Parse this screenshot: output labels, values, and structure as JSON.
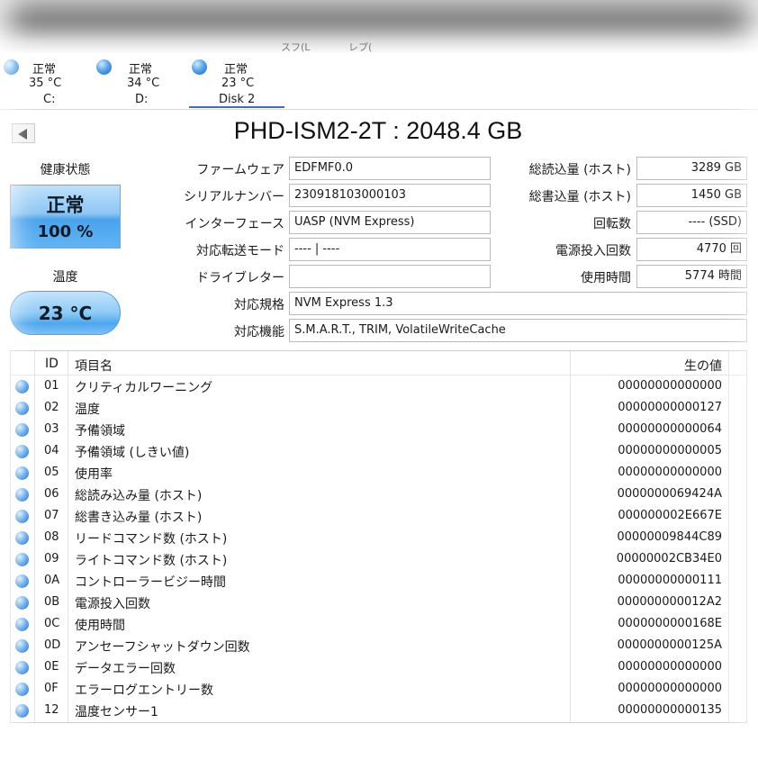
{
  "menu": [
    "スフ(L",
    "レプ("
  ],
  "disks": [
    {
      "status": "正常",
      "temp": "35 °C",
      "letter": "C:"
    },
    {
      "status": "正常",
      "temp": "34 °C",
      "letter": "D:"
    },
    {
      "status": "正常",
      "temp": "23 °C",
      "letter": "Disk 2"
    }
  ],
  "title": "PHD-ISM2-2T : 2048.4 GB",
  "health": {
    "label": "健康状態",
    "status": "正常",
    "percent": "100 %"
  },
  "temperature": {
    "label": "温度",
    "value": "23 °C"
  },
  "info_left": [
    {
      "label": "ファームウェア",
      "value": "EDFMF0.0"
    },
    {
      "label": "シリアルナンバー",
      "value": "230918103000103"
    },
    {
      "label": "インターフェース",
      "value": "UASP (NVM Express)"
    },
    {
      "label": "対応転送モード",
      "value": "---- | ----"
    },
    {
      "label": "ドライブレター",
      "value": ""
    }
  ],
  "info_right": [
    {
      "label": "総読込量 (ホスト)",
      "value": "3289 GB"
    },
    {
      "label": "総書込量 (ホスト)",
      "value": "1450 GB"
    },
    {
      "label": "回転数",
      "value": "---- (SSD)"
    },
    {
      "label": "電源投入回数",
      "value": "4770 回"
    },
    {
      "label": "使用時間",
      "value": "5774 時間"
    }
  ],
  "standard": {
    "label": "対応規格",
    "value": "NVM Express 1.3"
  },
  "features": {
    "label": "対応機能",
    "value": "S.M.A.R.T., TRIM, VolatileWriteCache"
  },
  "table": {
    "headers": {
      "id": "ID",
      "name": "項目名",
      "raw": "生の値"
    },
    "rows": [
      {
        "id": "01",
        "name": "クリティカルワーニング",
        "raw": "00000000000000"
      },
      {
        "id": "02",
        "name": "温度",
        "raw": "00000000000127"
      },
      {
        "id": "03",
        "name": "予備領域",
        "raw": "00000000000064"
      },
      {
        "id": "04",
        "name": "予備領域 (しきい値)",
        "raw": "00000000000005"
      },
      {
        "id": "05",
        "name": "使用率",
        "raw": "00000000000000"
      },
      {
        "id": "06",
        "name": "総読み込み量 (ホスト)",
        "raw": "0000000069424A"
      },
      {
        "id": "07",
        "name": "総書き込み量 (ホスト)",
        "raw": "000000002E667E"
      },
      {
        "id": "08",
        "name": "リードコマンド数 (ホスト)",
        "raw": "00000009844C89"
      },
      {
        "id": "09",
        "name": "ライトコマンド数 (ホスト)",
        "raw": "00000002CB34E0"
      },
      {
        "id": "0A",
        "name": "コントローラービジー時間",
        "raw": "00000000000111"
      },
      {
        "id": "0B",
        "name": "電源投入回数",
        "raw": "000000000012A2"
      },
      {
        "id": "0C",
        "name": "使用時間",
        "raw": "0000000000168E"
      },
      {
        "id": "0D",
        "name": "アンセーフシャットダウン回数",
        "raw": "0000000000125A"
      },
      {
        "id": "0E",
        "name": "データエラー回数",
        "raw": "00000000000000"
      },
      {
        "id": "0F",
        "name": "エラーログエントリー数",
        "raw": "00000000000000"
      },
      {
        "id": "12",
        "name": "温度センサー1",
        "raw": "00000000000135"
      }
    ]
  }
}
